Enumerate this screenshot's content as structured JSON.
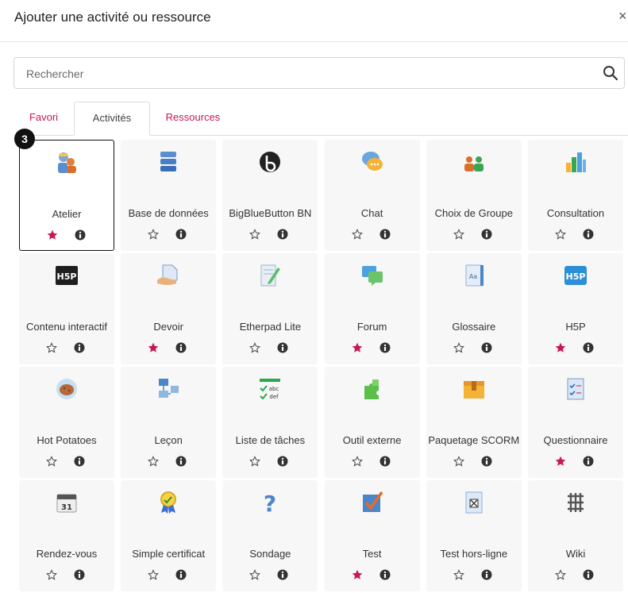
{
  "dialog": {
    "title": "Ajouter une activité ou ressource",
    "close_label": "×"
  },
  "search": {
    "placeholder": "Rechercher"
  },
  "tabs": [
    {
      "label": "Favori"
    },
    {
      "label": "Activités"
    },
    {
      "label": "Ressources"
    }
  ],
  "badge": "3",
  "colors": {
    "accent": "#c8194f",
    "star_filled": "#c8194f"
  },
  "items": [
    {
      "label": "Atelier",
      "icon": "workshop-icon",
      "starred": true
    },
    {
      "label": "Base de données",
      "icon": "database-icon",
      "starred": false
    },
    {
      "label": "BigBlueButton BN",
      "icon": "bigbluebutton-icon",
      "starred": false
    },
    {
      "label": "Chat",
      "icon": "chat-icon",
      "starred": false
    },
    {
      "label": "Choix de Groupe",
      "icon": "group-choice-icon",
      "starred": false
    },
    {
      "label": "Consultation",
      "icon": "bar-chart-icon",
      "starred": false
    },
    {
      "label": "Contenu interactif",
      "icon": "h5p-dark-icon",
      "starred": false
    },
    {
      "label": "Devoir",
      "icon": "assignment-icon",
      "starred": true
    },
    {
      "label": "Etherpad Lite",
      "icon": "etherpad-icon",
      "starred": false
    },
    {
      "label": "Forum",
      "icon": "forum-icon",
      "starred": true
    },
    {
      "label": "Glossaire",
      "icon": "glossary-icon",
      "starred": false
    },
    {
      "label": "H5P",
      "icon": "h5p-blue-icon",
      "starred": true
    },
    {
      "label": "Hot Potatoes",
      "icon": "hotpotatoes-icon",
      "starred": false
    },
    {
      "label": "Leçon",
      "icon": "lesson-icon",
      "starred": false
    },
    {
      "label": "Liste de tâches",
      "icon": "checklist-icon",
      "starred": false
    },
    {
      "label": "Outil externe",
      "icon": "puzzle-icon",
      "starred": false
    },
    {
      "label": "Paquetage SCORM",
      "icon": "scorm-package-icon",
      "starred": false
    },
    {
      "label": "Questionnaire",
      "icon": "questionnaire-icon",
      "starred": true
    },
    {
      "label": "Rendez-vous",
      "icon": "calendar-icon",
      "starred": false
    },
    {
      "label": "Simple certificat",
      "icon": "certificate-icon",
      "starred": false
    },
    {
      "label": "Sondage",
      "icon": "question-mark-icon",
      "starred": false
    },
    {
      "label": "Test",
      "icon": "quiz-checkmark-icon",
      "starred": true
    },
    {
      "label": "Test hors-ligne",
      "icon": "offline-quiz-icon",
      "starred": false
    },
    {
      "label": "Wiki",
      "icon": "wiki-icon",
      "starred": false
    }
  ]
}
